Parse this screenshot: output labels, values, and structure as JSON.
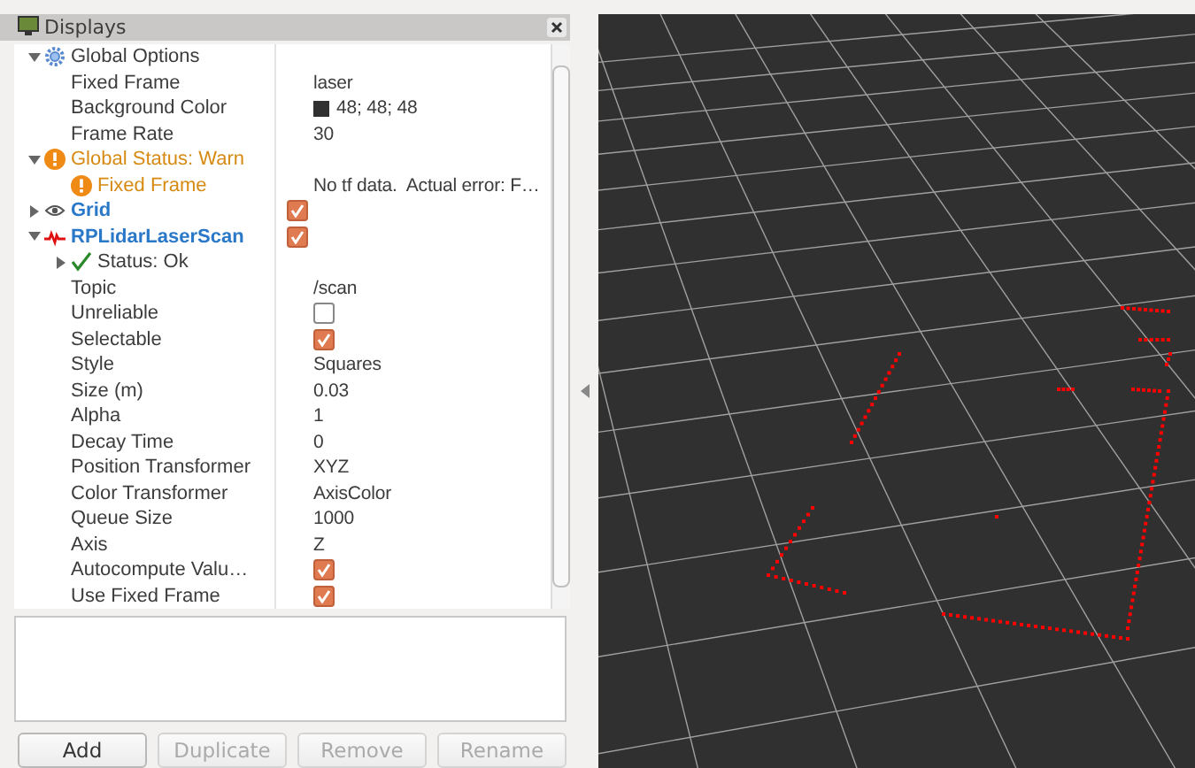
{
  "panel": {
    "title": "Displays"
  },
  "tree": [
    {
      "label": "Global Options",
      "kind": "options",
      "expanded": true,
      "children": [
        {
          "label": "Fixed Frame",
          "kind": "property",
          "value": "laser"
        },
        {
          "label": "Background Color",
          "kind": "property",
          "value": "48; 48; 48",
          "color": "#303030"
        },
        {
          "label": "Frame Rate",
          "kind": "property",
          "value": "30"
        }
      ]
    },
    {
      "label": "Global Status: Warn",
      "kind": "warn",
      "expanded": true,
      "children": [
        {
          "label": "Fixed Frame",
          "kind": "warn",
          "value": "No tf data.  Actual error: F…"
        }
      ]
    },
    {
      "label": "Grid",
      "kind": "grid",
      "expanded": false,
      "checked": true
    },
    {
      "label": "RPLidarLaserScan",
      "kind": "scan",
      "expanded": true,
      "checked": true,
      "children": [
        {
          "label": "Status: Ok",
          "kind": "ok",
          "expanded": false
        },
        {
          "label": "Topic",
          "kind": "property",
          "value": "/scan"
        },
        {
          "label": "Unreliable",
          "kind": "property",
          "checked": false
        },
        {
          "label": "Selectable",
          "kind": "property",
          "checked": true
        },
        {
          "label": "Style",
          "kind": "property",
          "value": "Squares"
        },
        {
          "label": "Size (m)",
          "kind": "property",
          "value": "0.03"
        },
        {
          "label": "Alpha",
          "kind": "property",
          "value": "1"
        },
        {
          "label": "Decay Time",
          "kind": "property",
          "value": "0"
        },
        {
          "label": "Position Transformer",
          "kind": "property",
          "value": "XYZ"
        },
        {
          "label": "Color Transformer",
          "kind": "property",
          "value": "AxisColor"
        },
        {
          "label": "Queue Size",
          "kind": "property",
          "value": "1000"
        },
        {
          "label": "Axis",
          "kind": "property",
          "value": "Z"
        },
        {
          "label": "Autocompute Valu…",
          "kind": "property",
          "checked": true
        },
        {
          "label": "Use Fixed Frame",
          "kind": "property",
          "checked": true
        }
      ]
    }
  ],
  "buttons": [
    {
      "label": "Add",
      "disabled": false
    },
    {
      "label": "Duplicate",
      "disabled": true
    },
    {
      "label": "Remove",
      "disabled": true
    },
    {
      "label": "Rename",
      "disabled": true
    }
  ]
}
